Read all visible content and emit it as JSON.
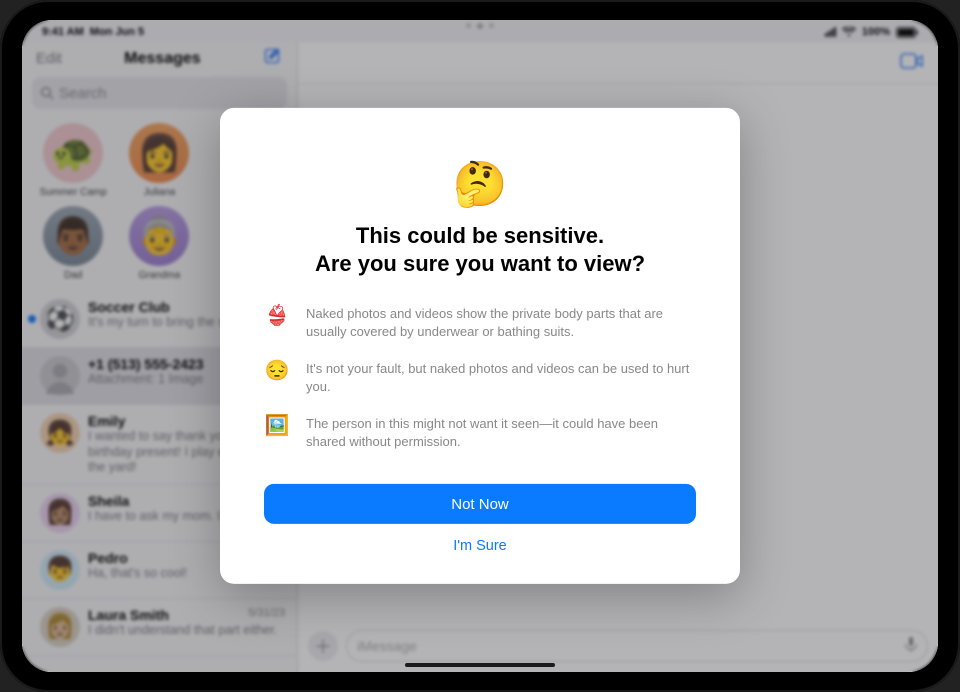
{
  "status": {
    "time": "9:41 AM",
    "date": "Mon Jun 5",
    "wifi": "wifi-icon",
    "battery_pct": "100%"
  },
  "sidebar": {
    "edit": "Edit",
    "title": "Messages",
    "search_placeholder": "Search",
    "pins": [
      {
        "label": "Summer Camp",
        "emoji": "🐢",
        "cls": "turtle"
      },
      {
        "label": "Juliana",
        "emoji": "👩",
        "cls": "juliana"
      },
      {
        "label": "",
        "emoji": "",
        "cls": ""
      },
      {
        "label": "Dad",
        "emoji": "👨🏾",
        "cls": "dad"
      },
      {
        "label": "Grandma",
        "emoji": "👵",
        "cls": "grandma"
      }
    ],
    "items": [
      {
        "name": "Soccer Club",
        "preview": "It's my turn to bring the snack!",
        "unread": true,
        "avatar": "⚽"
      },
      {
        "name": "+1 (513) 555-2423",
        "preview": "Attachment: 1 Image",
        "selected": true,
        "avatar": ""
      },
      {
        "name": "Emily",
        "preview": "I wanted to say thank you for the birthday present! I play every day in the yard!",
        "avatar": "👧"
      },
      {
        "name": "Sheila",
        "preview": "I have to ask my mom. I hope so!",
        "avatar": "👩🏽"
      },
      {
        "name": "Pedro",
        "preview": "Ha, that's so cool!",
        "avatar": "👦"
      },
      {
        "name": "Laura Smith",
        "preview": "I didn't understand that part either.",
        "date": "5/31/23",
        "avatar": "👩🏼"
      }
    ]
  },
  "chat": {
    "compose_placeholder": "iMessage"
  },
  "modal": {
    "emoji": "🤔",
    "title_line1": "This could be sensitive.",
    "title_line2": "Are you sure you want to view?",
    "bullets": [
      {
        "icon": "👙",
        "text": "Naked photos and videos show the private body parts that are usually covered by underwear or bathing suits."
      },
      {
        "icon": "😔",
        "text": "It's not your fault, but naked photos and videos can be used to hurt you."
      },
      {
        "icon": "🖼️",
        "text": "The person in this might not want it seen—it could have been shared without permission."
      }
    ],
    "primary": "Not Now",
    "secondary": "I'm Sure"
  }
}
